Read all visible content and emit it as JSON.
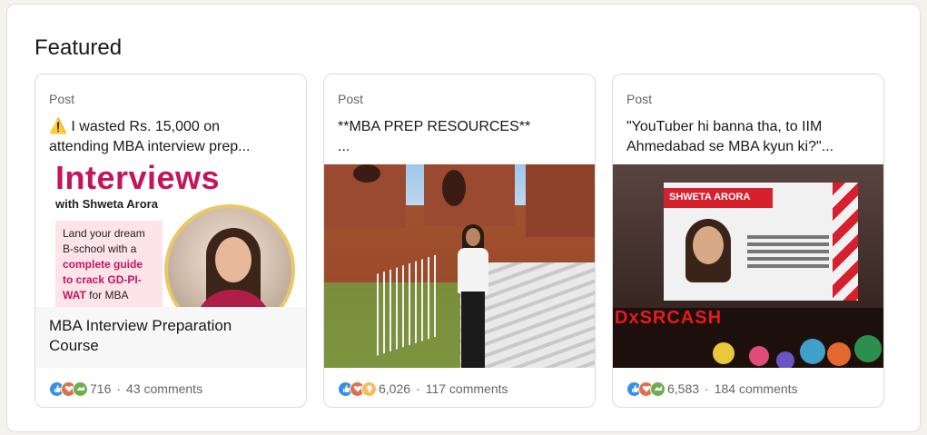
{
  "section": {
    "title": "Featured"
  },
  "cards": [
    {
      "type": "Post",
      "text_line1": "⚠️ I wasted Rs. 15,000 on",
      "text_line2": "attending MBA interview prep...",
      "media": {
        "headline": "Interviews",
        "subline": "with Shweta Arora",
        "box_line1": "Land your dream",
        "box_line2": "B-school with a",
        "box_bold1": "complete guide",
        "box_bold2": "to crack GD-PI-",
        "box_bold3": "WAT",
        "box_tail": " for MBA",
        "caption_line1": "MBA Interview Preparation",
        "caption_line2": "Course"
      },
      "reactions": [
        "like",
        "love",
        "support"
      ],
      "reaction_count": "716",
      "comments": "43 comments"
    },
    {
      "type": "Post",
      "text_line1": "**MBA PREP RESOURCES**",
      "text_line2": "...",
      "reactions": [
        "like",
        "love",
        "insightful"
      ],
      "reaction_count": "6,026",
      "comments": "117 comments"
    },
    {
      "type": "Post",
      "text_line1": "\"YouTuber hi banna tha, to IIM",
      "text_line2": "Ahmedabad se MBA kyun ki?\"...",
      "media": {
        "banner": "SHWETA ARORA",
        "stage_text": "DxSRCASH"
      },
      "reactions": [
        "like",
        "love",
        "support"
      ],
      "reaction_count": "6,583",
      "comments": "184 comments"
    }
  ],
  "colors": {
    "like": "#378fe9",
    "love": "#df704d",
    "support": "#6dae4f",
    "insightful": "#f5bb5c",
    "accent": "#c4155a"
  }
}
